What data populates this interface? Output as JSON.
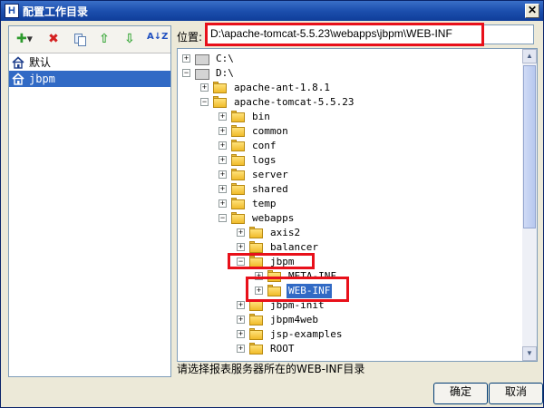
{
  "window": {
    "title": "配置工作目录",
    "app_icon_letter": "H",
    "close_glyph": "✕"
  },
  "toolbar": {
    "add_icon": "plus-icon",
    "delete_icon": "red-x-icon",
    "copy_icon": "copy-icon",
    "up_icon": "green-up-arrow-icon",
    "down_icon": "green-down-arrow-icon",
    "sort_icon": "az-sort-icon",
    "add_glyph": "✚",
    "delete_glyph": "✖",
    "up_glyph": "⇧",
    "down_glyph": "⇩",
    "sort_glyph": "A↓Z"
  },
  "workspaces": [
    {
      "label": "默认",
      "selected": false
    },
    {
      "label": "jbpm",
      "selected": true
    }
  ],
  "location": {
    "label": "位置:",
    "value": "D:\\apache-tomcat-5.5.23\\webapps\\jbpm\\WEB-INF"
  },
  "tree": [
    {
      "label": "C:\\",
      "expanded": false,
      "icon": "drive-icon",
      "selected": false
    },
    {
      "label": "D:\\",
      "expanded": true,
      "icon": "drive-icon",
      "selected": false
    },
    {
      "label": "apache-ant-1.8.1",
      "expanded": false,
      "icon": "folder-icon",
      "selected": false
    },
    {
      "label": "apache-tomcat-5.5.23",
      "expanded": true,
      "icon": "folder-icon",
      "selected": false
    },
    {
      "label": "bin",
      "expanded": false,
      "icon": "folder-icon",
      "selected": false
    },
    {
      "label": "common",
      "expanded": false,
      "icon": "folder-icon",
      "selected": false
    },
    {
      "label": "conf",
      "expanded": false,
      "icon": "folder-icon",
      "selected": false
    },
    {
      "label": "logs",
      "expanded": false,
      "icon": "folder-icon",
      "selected": false
    },
    {
      "label": "server",
      "expanded": false,
      "icon": "folder-icon",
      "selected": false
    },
    {
      "label": "shared",
      "expanded": false,
      "icon": "folder-icon",
      "selected": false
    },
    {
      "label": "temp",
      "expanded": false,
      "icon": "folder-icon",
      "selected": false
    },
    {
      "label": "webapps",
      "expanded": true,
      "icon": "folder-icon",
      "selected": false
    },
    {
      "label": "axis2",
      "expanded": false,
      "icon": "folder-icon",
      "selected": false
    },
    {
      "label": "balancer",
      "expanded": false,
      "icon": "folder-icon",
      "selected": false
    },
    {
      "label": "jbpm",
      "expanded": true,
      "icon": "folder-icon",
      "selected": false
    },
    {
      "label": "META-INF",
      "expanded": false,
      "icon": "folder-icon",
      "selected": false
    },
    {
      "label": "WEB-INF",
      "expanded": false,
      "icon": "folder-icon",
      "selected": true
    },
    {
      "label": "jbpm-init",
      "expanded": false,
      "icon": "folder-icon",
      "selected": false
    },
    {
      "label": "jbpm4web",
      "expanded": false,
      "icon": "folder-icon",
      "selected": false
    },
    {
      "label": "jsp-examples",
      "expanded": false,
      "icon": "folder-icon",
      "selected": false
    },
    {
      "label": "ROOT",
      "expanded": false,
      "icon": "folder-icon",
      "selected": false
    }
  ],
  "status": {
    "text": "请选择报表服务器所在的WEB-INF目录"
  },
  "buttons": {
    "ok": "确定",
    "cancel": "取消"
  },
  "colors": {
    "highlight": "#e8101a",
    "selection": "#316ac5",
    "title_bar": "#1c4fae"
  }
}
